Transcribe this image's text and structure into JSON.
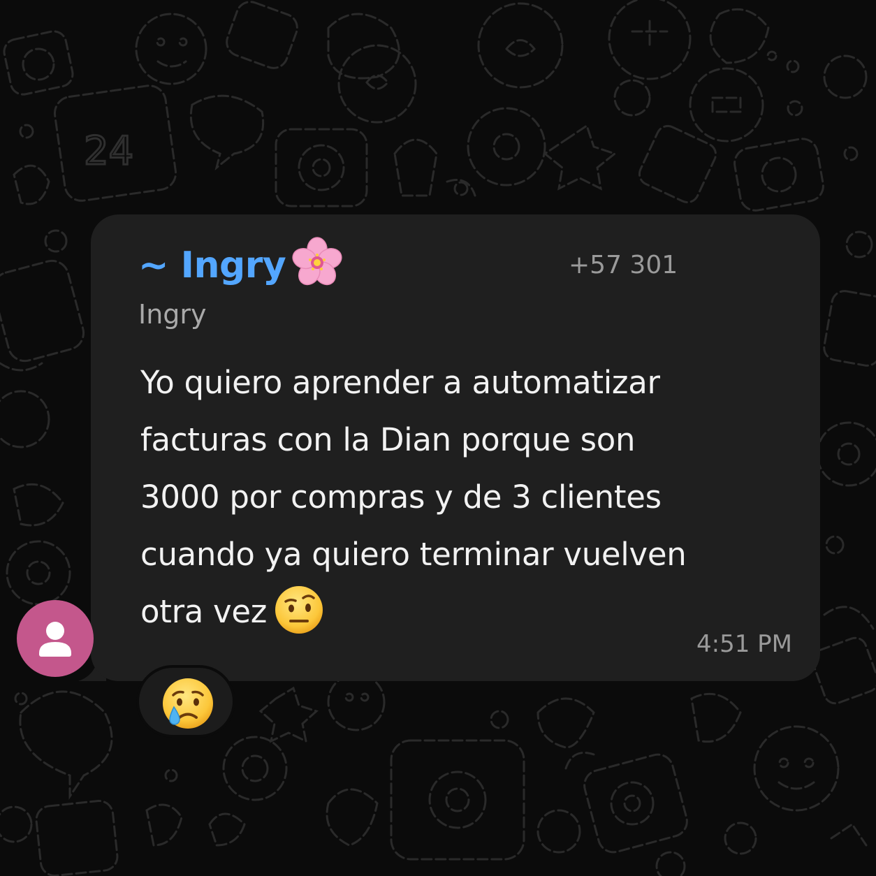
{
  "message": {
    "sender_name": "~ Ingry",
    "sender_emoji": "flower-emoji",
    "sender_phone": "+57 301",
    "sender_pushname": "Ingry",
    "lines": [
      "Yo quiero aprender a automatizar",
      "facturas con la Dian porque son",
      "3000 por compras y de 3 clientes",
      "cuando ya quiero terminar vuelven",
      "otra vez"
    ],
    "trailing_emoji": "face-with-raised-eyebrow-emoji",
    "time": "4:51 PM"
  },
  "reaction": {
    "emoji": "crying-face-emoji"
  },
  "avatar": {
    "icon": "person-icon",
    "color": "#c4578c"
  },
  "colors": {
    "background": "#0b0b0b",
    "bubble": "#1f1f1f",
    "sender_name": "#53a6ff",
    "meta_text": "#9a9a9a",
    "message_text": "#f2f2f2"
  }
}
